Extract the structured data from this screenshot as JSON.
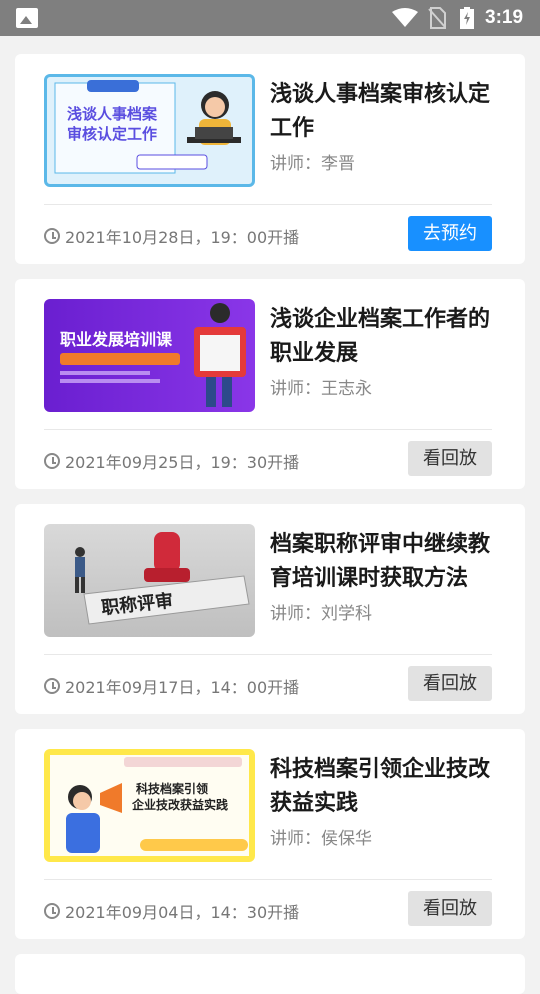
{
  "status_bar": {
    "time": "3:19"
  },
  "courses": [
    {
      "thumb_text": [
        "浅谈人事档案",
        "审核认定工作"
      ],
      "title": "浅谈人事档案审核认定工作",
      "lecturer": "讲师：李晋",
      "datetime": "2021年10月28日，19：00开播",
      "action": "去预约",
      "action_style": "primary"
    },
    {
      "thumb_text": [
        "职业发展培训课"
      ],
      "title": "浅谈企业档案工作者的职业发展",
      "lecturer": "讲师：王志永",
      "datetime": "2021年09月25日，19：30开播",
      "action": "看回放",
      "action_style": "secondary"
    },
    {
      "thumb_text": [
        "职称评审"
      ],
      "title": "档案职称评审中继续教育培训课时获取方法",
      "lecturer": "讲师：刘学科",
      "datetime": "2021年09月17日，14：00开播",
      "action": "看回放",
      "action_style": "secondary"
    },
    {
      "thumb_text": [
        "科技档案引领",
        "企业技改获益实践"
      ],
      "title": "科技档案引领企业技改获益实践",
      "lecturer": "讲师：侯保华",
      "datetime": "2021年09月04日，14：30开播",
      "action": "看回放",
      "action_style": "secondary"
    }
  ]
}
